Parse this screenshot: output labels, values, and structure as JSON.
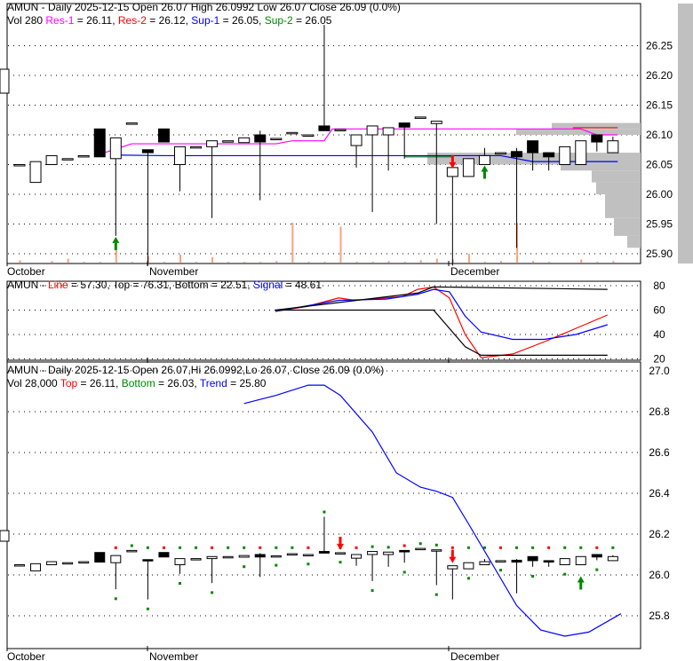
{
  "chart_data": [
    {
      "type": "candlestick",
      "title": "AMUN - Daily 2025-12-15 Open 26.07  High 26.0992  Low 26.07  Close 26.09 (0.0%)",
      "header": {
        "line1": "AMUN - Daily 2025-12-15 Open 26.07  High 26.0992  Low 26.07  Close 26.09 (0.0%)",
        "vol": "Vol 280",
        "res1_label": "Res-1",
        "res1_val": " = 26.11, ",
        "res2_label": "Res-2",
        "res2_val": " = 26.12, ",
        "sup1_label": "Sup-1",
        "sup1_val": " = 26.05, ",
        "sup2_label": "Sup-2",
        "sup2_val": " = 26.05"
      },
      "yticks": [
        "26.25",
        "26.20",
        "26.15",
        "26.10",
        "26.05",
        "26.00",
        "25.95",
        "25.90"
      ],
      "ylim": [
        25.88,
        26.33
      ],
      "xlabels": [
        "October",
        "November",
        "December"
      ],
      "colors": {
        "res1": "#ff00ff",
        "res2": "#ff0000",
        "sup1": "#0000ff",
        "sup2": "#008000",
        "volume": "#ffa07a",
        "vbp": "#c0c0c0"
      }
    },
    {
      "type": "line",
      "header": {
        "name": "AMUN - ",
        "line_label": "Line",
        "line_val": " = 57.30, Top = 76.31, Bottom = 22.51, ",
        "signal_label": "Signal",
        "signal_val": " = 48.61"
      },
      "yticks": [
        "80",
        "60",
        "40",
        "20"
      ],
      "ylim": [
        18,
        82
      ],
      "series": [
        {
          "name": "Line",
          "color": "#ff0000",
          "points": [
            [
              0,
              59
            ],
            [
              2,
              63
            ],
            [
              4,
              70
            ],
            [
              5,
              68
            ],
            [
              7,
              70
            ],
            [
              8,
              71
            ],
            [
              9,
              77
            ],
            [
              10,
              79
            ],
            [
              11,
              70
            ],
            [
              12,
              40
            ],
            [
              13,
              21
            ],
            [
              15,
              24
            ],
            [
              17,
              34
            ],
            [
              19,
              45
            ],
            [
              21,
              56
            ]
          ]
        },
        {
          "name": "Signal",
          "color": "#0000ff",
          "points": [
            [
              0,
              59
            ],
            [
              4,
              68
            ],
            [
              7,
              69
            ],
            [
              9,
              73
            ],
            [
              10,
              77
            ],
            [
              11,
              75
            ],
            [
              12,
              55
            ],
            [
              13,
              42
            ],
            [
              15,
              36
            ],
            [
              17,
              36
            ],
            [
              19,
              40
            ],
            [
              21,
              48
            ]
          ]
        },
        {
          "name": "Top",
          "color": "#000000",
          "points": [
            [
              0,
              60
            ],
            [
              9,
              74
            ],
            [
              10,
              79
            ],
            [
              21,
              77
            ]
          ]
        },
        {
          "name": "Bottom",
          "color": "#000000",
          "points": [
            [
              0,
              60
            ],
            [
              10,
              60
            ],
            [
              12,
              30
            ],
            [
              13,
              23
            ],
            [
              21,
              23
            ]
          ]
        }
      ]
    },
    {
      "type": "candlestick",
      "header": {
        "line1": "AMUN - Daily 2025-12-15 Open 26.07,Hi 26.0992,Lo 26.07, Close 26.09 (0.0%)",
        "vol": "Vol 28,000 ",
        "top_label": "Top",
        "top_val": " = 26.11, ",
        "bottom_label": "Bottom",
        "bottom_val": " = 26.03, ",
        "trend_label": "Trend",
        "trend_val": " = 25.80"
      },
      "yticks": [
        "27.0",
        "26.8",
        "26.6",
        "26.4",
        "26.2",
        "26.0",
        "25.8"
      ],
      "ylim": [
        25.66,
        27.04
      ],
      "trend": [
        [
          14,
          26.84
        ],
        [
          16,
          26.88
        ],
        [
          18,
          26.93
        ],
        [
          19,
          26.93
        ],
        [
          20,
          26.88
        ],
        [
          22,
          26.7
        ],
        [
          23.5,
          26.5
        ],
        [
          25,
          26.43
        ],
        [
          26,
          26.41
        ],
        [
          27,
          26.38
        ],
        [
          28,
          26.25
        ],
        [
          29.5,
          26.05
        ],
        [
          31,
          25.85
        ],
        [
          32.5,
          25.73
        ],
        [
          34,
          25.7
        ],
        [
          35.5,
          25.72
        ],
        [
          37.5,
          25.81
        ]
      ]
    }
  ],
  "candles": [
    [
      26.05,
      26.05,
      26.05,
      26.05
    ],
    [
      26.02,
      26.055,
      26.02,
      26.055
    ],
    [
      26.05,
      26.065,
      26.05,
      26.065
    ],
    [
      26.06,
      26.06,
      26.06,
      26.06
    ],
    [
      26.065,
      26.065,
      26.065,
      26.065
    ],
    [
      26.11,
      26.11,
      26.063,
      26.063
    ],
    [
      26.06,
      26.095,
      25.93,
      26.095
    ],
    [
      26.12,
      26.12,
      26.12,
      26.12
    ],
    [
      26.075,
      26.075,
      25.88,
      26.07
    ],
    [
      26.11,
      26.11,
      26.088,
      26.088
    ],
    [
      26.05,
      26.08,
      26.005,
      26.08
    ],
    [
      26.08,
      26.08,
      26.08,
      26.08
    ],
    [
      26.08,
      26.09,
      25.96,
      26.09
    ],
    [
      26.09,
      26.09,
      26.09,
      26.09
    ],
    [
      26.087,
      26.095,
      26.087,
      26.095
    ],
    [
      26.1,
      26.107,
      25.99,
      26.088
    ],
    [
      26.094,
      26.094,
      26.094,
      26.094
    ],
    [
      26.104,
      26.104,
      26.104,
      26.104
    ],
    [
      26.1,
      26.1,
      26.1,
      26.1
    ],
    [
      26.115,
      26.285,
      26.107,
      26.107
    ],
    [
      26.109,
      26.109,
      26.109,
      26.109
    ],
    [
      26.082,
      26.1,
      26.045,
      26.1
    ],
    [
      26.1,
      26.115,
      25.97,
      26.115
    ],
    [
      26.1,
      26.112,
      26.04,
      26.112
    ],
    [
      26.12,
      26.12,
      26.06,
      26.113
    ],
    [
      26.13,
      26.13,
      26.13,
      26.13
    ],
    [
      26.119,
      26.123,
      25.95,
      26.123
    ],
    [
      26.03,
      26.045,
      25.88,
      26.045
    ],
    [
      26.03,
      26.06,
      26.03,
      26.06
    ],
    [
      26.05,
      26.078,
      26.05,
      26.065
    ],
    [
      26.07,
      26.07,
      26.07,
      26.07
    ],
    [
      26.072,
      26.078,
      25.91,
      26.063
    ],
    [
      26.09,
      26.09,
      26.04,
      26.07
    ],
    [
      26.07,
      26.07,
      26.04,
      26.063
    ],
    [
      26.05,
      26.08,
      26.05,
      26.08
    ],
    [
      26.05,
      26.09,
      26.05,
      26.09
    ],
    [
      26.1,
      26.1,
      26.072,
      26.088
    ],
    [
      26.07,
      26.097,
      26.07,
      26.09
    ]
  ],
  "volumes": [
    3,
    0,
    2,
    5,
    1,
    1,
    30,
    1,
    8,
    1,
    10,
    1,
    7,
    1,
    1,
    1,
    2,
    50,
    1,
    1,
    45,
    1,
    1,
    2,
    1,
    3,
    5,
    4,
    11,
    1,
    2,
    50,
    2,
    1,
    0,
    4,
    1,
    2
  ],
  "arrows": [
    {
      "i": 6,
      "dir": "up"
    },
    {
      "i": 27,
      "dir": "down"
    },
    {
      "i": 29,
      "dir": "up"
    }
  ],
  "arrows_bottom": [
    {
      "i": 20,
      "dir": "down"
    },
    {
      "i": 27,
      "dir": "down"
    },
    {
      "i": 35,
      "dir": "up"
    }
  ]
}
